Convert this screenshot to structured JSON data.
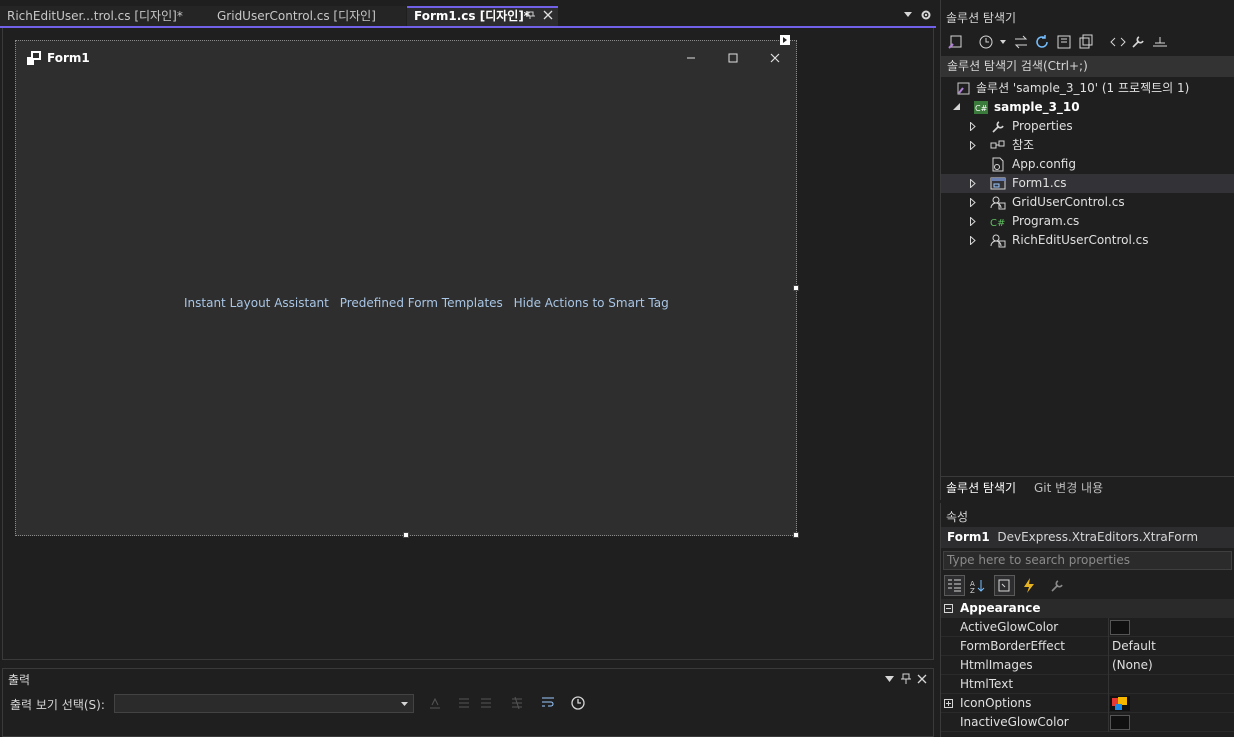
{
  "tabs": [
    {
      "label": "RichEditUser...trol.cs [디자인]*",
      "active": false
    },
    {
      "label": "GridUserControl.cs [디자인]",
      "active": false
    },
    {
      "label": "Form1.cs [디자인]*",
      "active": true
    }
  ],
  "designer": {
    "form_title": "Form1",
    "smart_actions": [
      "Instant Layout Assistant",
      "Predefined Form Templates",
      "Hide Actions to Smart Tag"
    ]
  },
  "output": {
    "title": "출력",
    "select_label": "출력 보기 선택(S):",
    "select_value": ""
  },
  "solution_explorer": {
    "title": "솔루션 탐색기",
    "search_placeholder": "솔루션 탐색기 검색(Ctrl+;)",
    "solution": "솔루션 'sample_3_10' (1 프로젝트의 1)",
    "project": "sample_3_10",
    "items": [
      {
        "label": "Properties",
        "icon": "wrench-icon",
        "expandable": true,
        "selected": false
      },
      {
        "label": "참조",
        "icon": "references-icon",
        "expandable": true,
        "selected": false
      },
      {
        "label": "App.config",
        "icon": "config-file-icon",
        "expandable": false,
        "selected": false
      },
      {
        "label": "Form1.cs",
        "icon": "form-icon",
        "expandable": true,
        "selected": true
      },
      {
        "label": "GridUserControl.cs",
        "icon": "user-control-icon",
        "expandable": true,
        "selected": false
      },
      {
        "label": "Program.cs",
        "icon": "csharp-file-icon",
        "expandable": true,
        "selected": false
      },
      {
        "label": "RichEditUserControl.cs",
        "icon": "user-control-icon",
        "expandable": true,
        "selected": false
      }
    ],
    "bottom_tabs": [
      "솔루션 탐색기",
      "Git 변경 내용"
    ]
  },
  "properties": {
    "title": "속성",
    "object_name": "Form1",
    "object_type": "DevExpress.XtraEditors.XtraForm",
    "search_placeholder": "Type here to search properties",
    "category": "Appearance",
    "rows": [
      {
        "name": "ActiveGlowColor",
        "value": "",
        "swatch": "#111111",
        "expandable": false
      },
      {
        "name": "FormBorderEffect",
        "value": "Default",
        "swatch": null,
        "expandable": false
      },
      {
        "name": "HtmlImages",
        "value": "(None)",
        "swatch": null,
        "expandable": false
      },
      {
        "name": "HtmlText",
        "value": "",
        "swatch": null,
        "expandable": false
      },
      {
        "name": "IconOptions",
        "value": "",
        "swatch": "icon",
        "expandable": true
      },
      {
        "name": "InactiveGlowColor",
        "value": "",
        "swatch": "#111111",
        "expandable": false
      }
    ]
  },
  "colors": {
    "accent": "#7160e8",
    "link": "#a9c6e6",
    "background": "#1f1f1f"
  }
}
